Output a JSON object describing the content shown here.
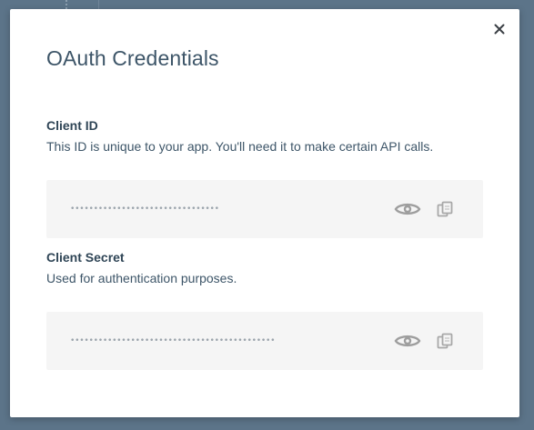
{
  "modal": {
    "title": "OAuth Credentials",
    "close_icon": "close-icon"
  },
  "client_id": {
    "label": "Client ID",
    "description": "This ID is unique to your app. You'll need it to make certain API calls.",
    "masked_value": "••••••••••••••••••••••••••••••••",
    "reveal_icon": "eye-icon",
    "copy_icon": "copy-icon"
  },
  "client_secret": {
    "label": "Client Secret",
    "description": "Used for authentication purposes.",
    "masked_value": "••••••••••••••••••••••••••••••••••••••••••••",
    "reveal_icon": "eye-icon",
    "copy_icon": "copy-icon"
  },
  "colors": {
    "backdrop": "#5c7489",
    "title": "#3d5568",
    "field_bg": "#f5f5f5",
    "icon": "#9e9e9e"
  }
}
